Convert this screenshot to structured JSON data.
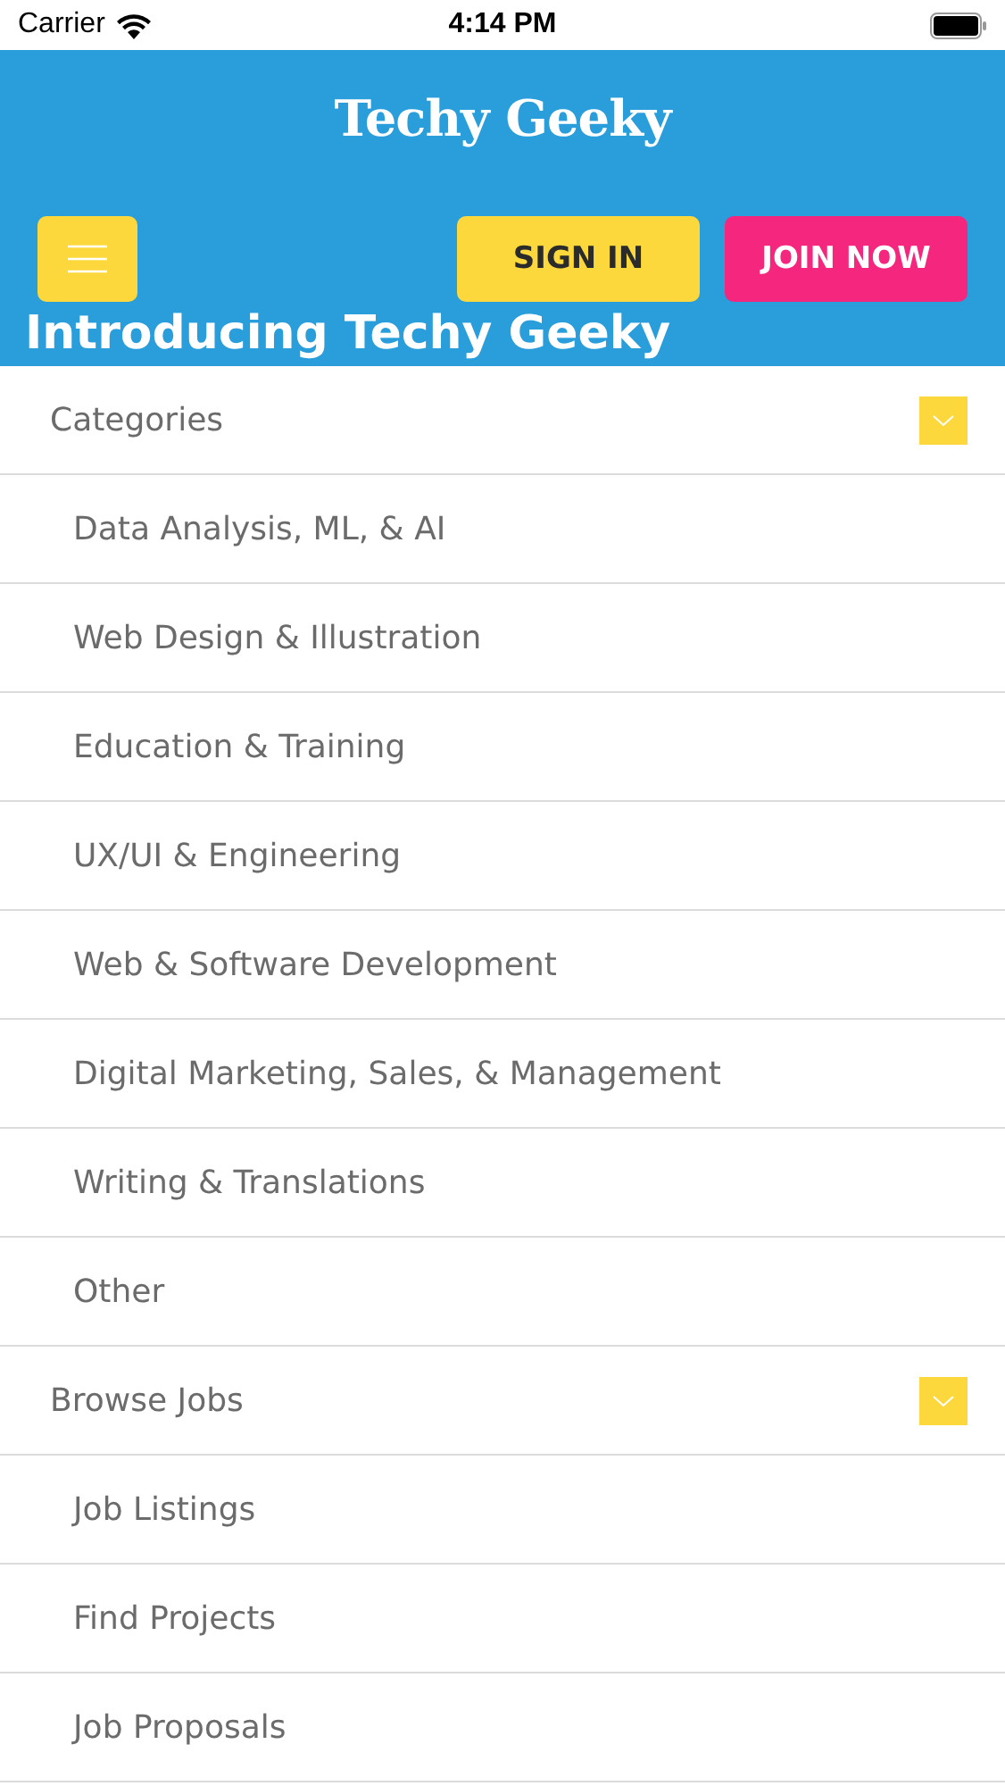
{
  "status_bar": {
    "carrier": "Carrier",
    "time": "4:14 PM"
  },
  "header": {
    "logo": "Techy Geeky",
    "sign_in": "SIGN IN",
    "join": "JOIN NOW",
    "headline": "Introducing Techy Geeky"
  },
  "menu": [
    {
      "label": "Categories",
      "expanded": true,
      "children": [
        "Data Analysis, ML, & AI",
        "Web Design & Illustration",
        "Education & Training",
        "UX/UI & Engineering",
        "Web & Software Development",
        "Digital Marketing, Sales, & Management",
        "Writing & Translations",
        "Other"
      ]
    },
    {
      "label": "Browse Jobs",
      "expanded": true,
      "children": [
        "Job Listings",
        "Find Projects",
        "Job Proposals"
      ]
    }
  ]
}
